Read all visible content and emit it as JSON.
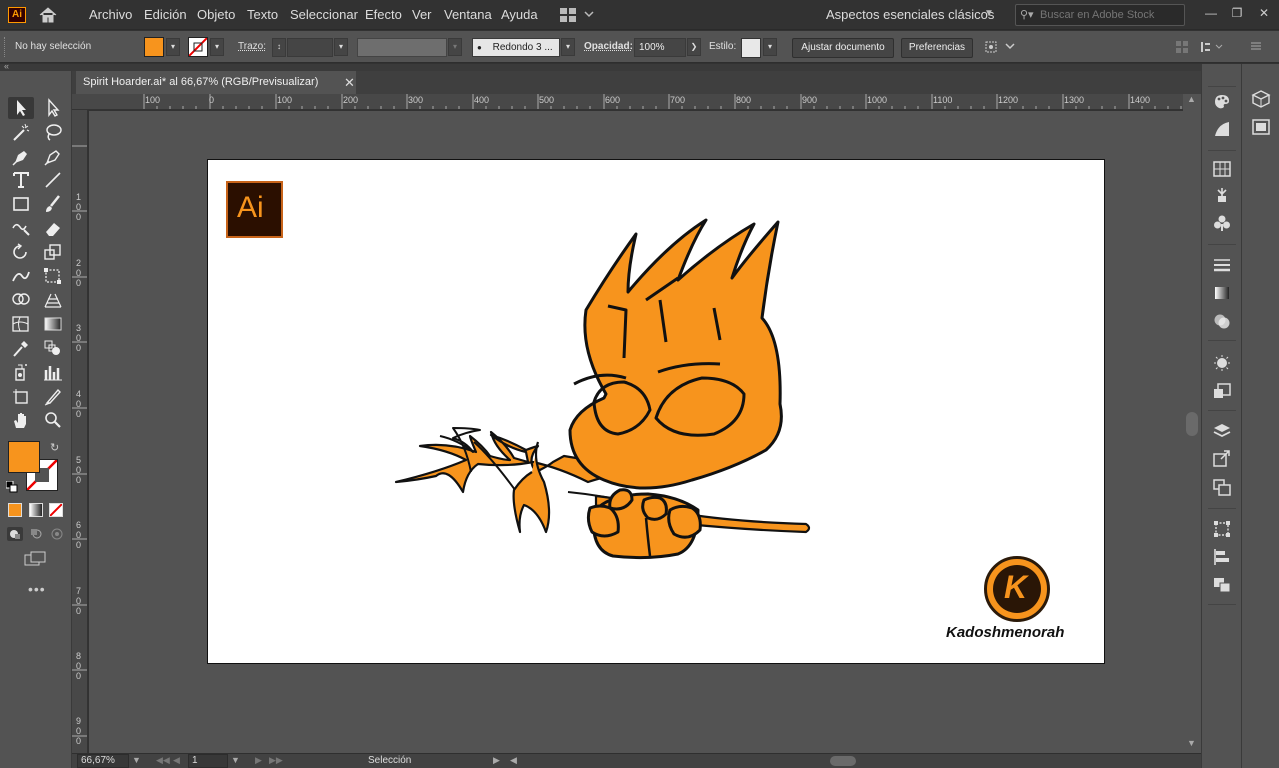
{
  "app": {
    "logo_text": "Ai"
  },
  "menu": [
    "Archivo",
    "Edición",
    "Objeto",
    "Texto",
    "Seleccionar",
    "Efecto",
    "Ver",
    "Ventana",
    "Ayuda"
  ],
  "workspace": "Aspectos esenciales clásicos",
  "search": {
    "placeholder": "Buscar en Adobe Stock"
  },
  "control": {
    "selection_text": "No hay selección",
    "fill_color": "#f7941d",
    "stroke_label": "Trazo:",
    "brush_label": "Redondo 3 ...",
    "opacity_label": "Opacidad:",
    "opacity_value": "100%",
    "style_label": "Estilo:",
    "fit_doc_button": "Ajustar documento",
    "prefs_button": "Preferencias"
  },
  "document": {
    "tab_title": "Spirit Hoarder.ai* al 66,67% (RGB/Previsualizar)"
  },
  "ruler_top": [
    "100",
    "0",
    "100",
    "200",
    "300",
    "400",
    "500",
    "600",
    "700",
    "800",
    "900",
    "1000",
    "1100",
    "1200",
    "1300",
    "1400"
  ],
  "ruler_left": [
    "1\n0\n0",
    "2\n0\n0",
    "3\n0\n0",
    "4\n0\n0",
    "5\n0\n0",
    "6\n0\n0",
    "7\n0\n0",
    "8\n0\n0",
    "9\n0\n0"
  ],
  "artboard": {
    "ai_badge": "Ai",
    "brand_letter": "K",
    "brand_name": "Kadoshmenorah",
    "brand_color": "#f7941d"
  },
  "status": {
    "zoom": "66,67%",
    "artboard_num": "1",
    "tool_name": "Selección"
  },
  "colors": {
    "orange": "#f7941d",
    "dark": "#111111"
  }
}
